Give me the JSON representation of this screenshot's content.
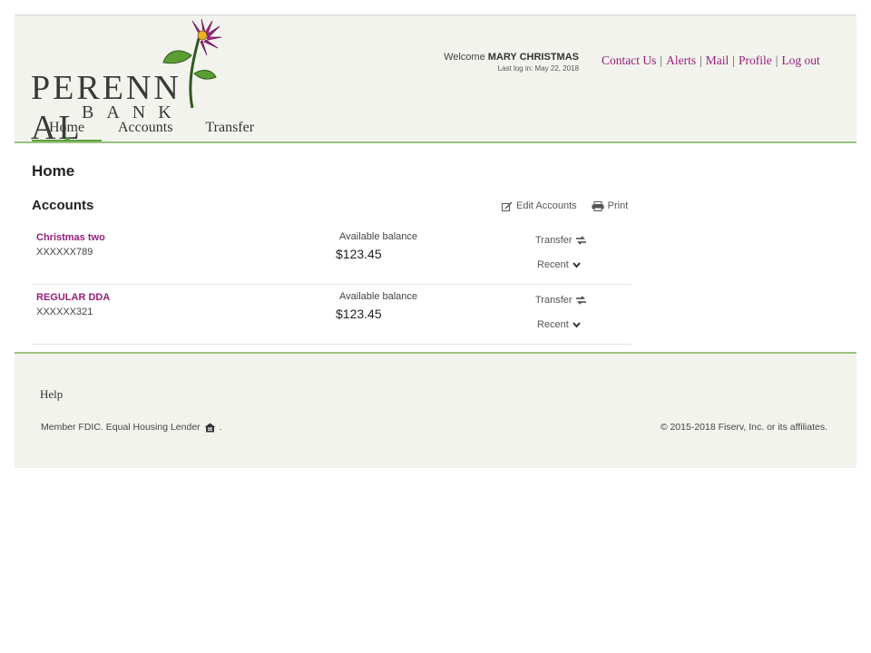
{
  "brand": {
    "line1": "PERENN",
    "line1b": "AL",
    "line2": "BANK"
  },
  "user": {
    "welcome_prefix": "Welcome ",
    "name": "MARY CHRISTMAS",
    "last_login": "Last log in: May 22, 2018"
  },
  "top_links": [
    "Contact Us",
    "Alerts",
    "Mail",
    "Profile",
    "Log out"
  ],
  "top_link_separator": "|",
  "nav": {
    "items": [
      "Home",
      "Accounts",
      "Transfer"
    ],
    "active": "Home"
  },
  "page": {
    "title": "Home",
    "section": "Accounts"
  },
  "tools": {
    "edit": "Edit Accounts",
    "print": "Print"
  },
  "accounts": [
    {
      "name": "Christmas two",
      "number": "XXXXXX789",
      "balance_label": "Available balance",
      "balance": "$123.45",
      "transfer": "Transfer",
      "recent": "Recent"
    },
    {
      "name": "REGULAR DDA",
      "number": "XXXXXX321",
      "balance_label": "Available balance",
      "balance": "$123.45",
      "transfer": "Transfer",
      "recent": "Recent"
    }
  ],
  "footer": {
    "help": "Help",
    "fdic": "Member FDIC. Equal Housing Lender",
    "fdic_end": ".",
    "copyright": "© 2015-2018 Fiserv, Inc. or its affiliates."
  },
  "colors": {
    "accent": "#96207a",
    "rule": "#9cc17e",
    "nav_active": "#5aa23e",
    "panel": "#f3f3ed"
  }
}
